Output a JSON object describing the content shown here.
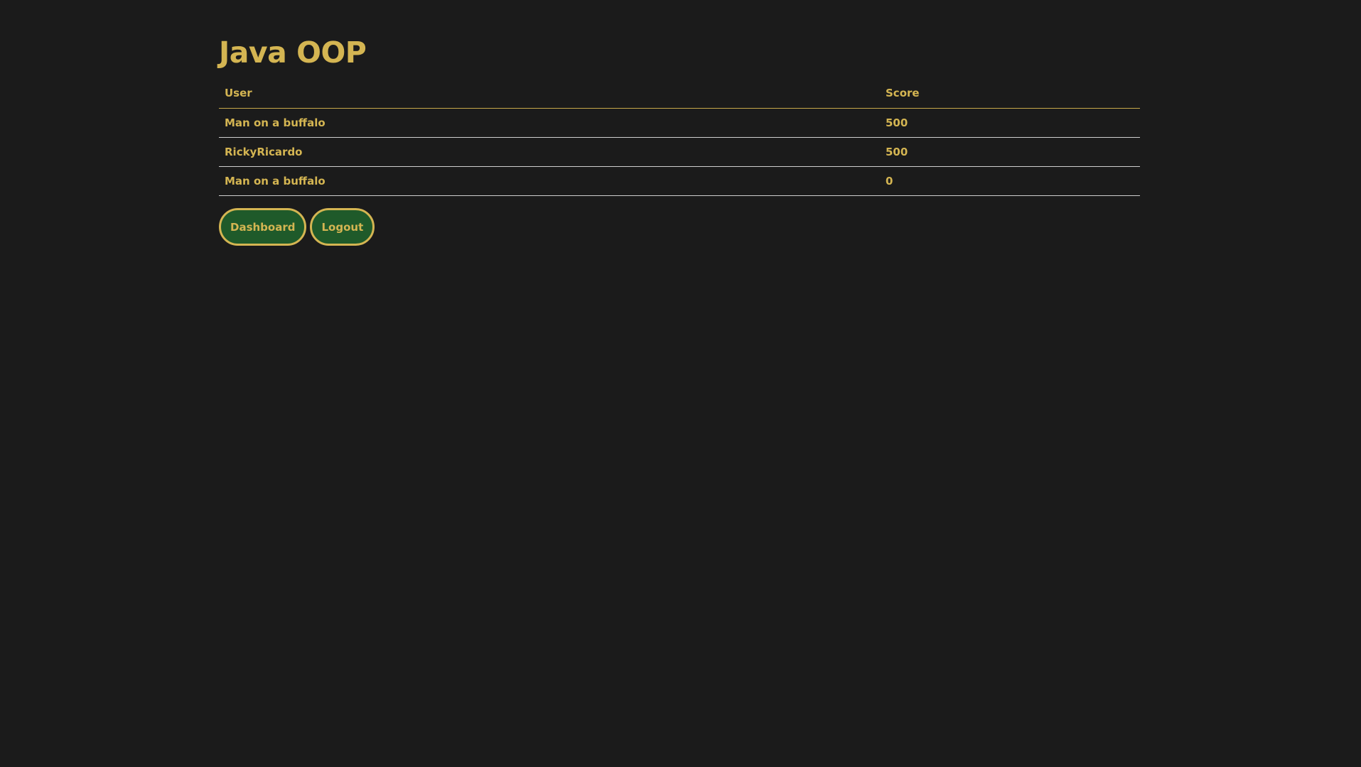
{
  "page": {
    "title": "Java OOP"
  },
  "table": {
    "headers": {
      "user": "User",
      "score": "Score"
    },
    "rows": [
      {
        "user": "Man on a buffalo",
        "score": "500"
      },
      {
        "user": "RickyRicardo",
        "score": "500"
      },
      {
        "user": "Man on a buffalo",
        "score": "0"
      }
    ]
  },
  "actions": {
    "dashboard_label": "Dashboard",
    "logout_label": "Logout"
  },
  "colors": {
    "background": "#1b1b1b",
    "accent_gold": "#d4b552",
    "button_green": "#1f5a2a",
    "row_divider": "#cfcfcf"
  }
}
